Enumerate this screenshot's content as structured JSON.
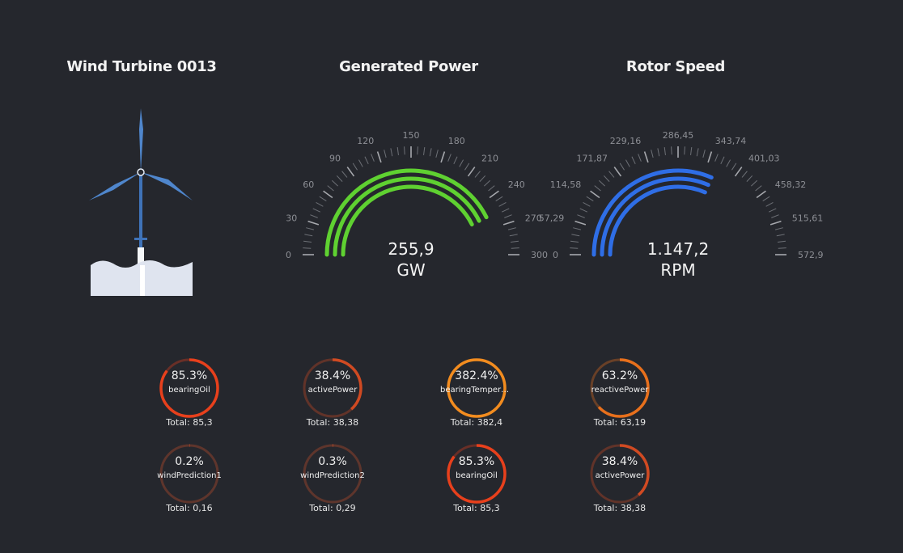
{
  "titles": {
    "turbine": "Wind Turbine 0013",
    "power": "Generated Power",
    "rotor": "Rotor Speed"
  },
  "gauges": {
    "power": {
      "value": "255,9",
      "unit": "GW",
      "ticks": [
        "0",
        "30",
        "60",
        "90",
        "120",
        "150",
        "180",
        "210",
        "240",
        "270",
        "300"
      ],
      "fraction": 0.853,
      "color": "#5fd131"
    },
    "rotor": {
      "value": "1.147,2",
      "unit": "RPM",
      "ticks": [
        "0",
        "57,29",
        "114,58",
        "171,87",
        "229,16",
        "286,45",
        "343,74",
        "401,03",
        "458,32",
        "515,61",
        "572,9"
      ],
      "fraction": 0.63,
      "color": "#2f6ee6"
    }
  },
  "donuts": [
    {
      "percent": "85.3%",
      "label": "bearingOil",
      "total": "Total: 85,3",
      "fraction": 0.853,
      "color": "#e8401c"
    },
    {
      "percent": "38.4%",
      "label": "activePower",
      "total": "Total: 38,38",
      "fraction": 0.384,
      "color": "#d04a22"
    },
    {
      "percent": "382.4%",
      "label": "bearingTemperatu...",
      "total": "Total: 382,4",
      "fraction": 1.0,
      "color": "#f28c1f"
    },
    {
      "percent": "63.2%",
      "label": "reactivePower",
      "total": "Total: 63,19",
      "fraction": 0.632,
      "color": "#e8701c"
    },
    {
      "percent": "0.2%",
      "label": "windPrediction1",
      "total": "Total: 0,16",
      "fraction": 0.002,
      "color": "#c9502a"
    },
    {
      "percent": "0.3%",
      "label": "windPrediction2",
      "total": "Total: 0,29",
      "fraction": 0.003,
      "color": "#c9502a"
    },
    {
      "percent": "85.3%",
      "label": "bearingOil",
      "total": "Total: 85,3",
      "fraction": 0.853,
      "color": "#e8401c"
    },
    {
      "percent": "38.4%",
      "label": "activePower",
      "total": "Total: 38,38",
      "fraction": 0.384,
      "color": "#d04a22"
    }
  ]
}
